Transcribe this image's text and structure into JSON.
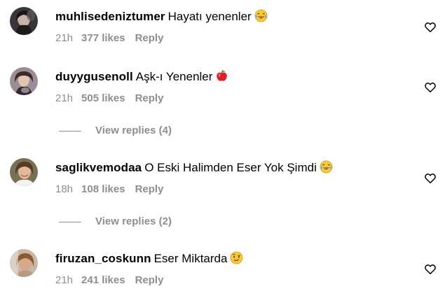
{
  "comments": [
    {
      "username": "muhlisedeniztumer",
      "text": "Hayatı yenenler",
      "emoji": "tears-of-joy-emoji",
      "time": "21h",
      "likes": "377 likes",
      "reply": "Reply"
    },
    {
      "username": "duyygusenoll",
      "text": "Aşk-ı Yenenler",
      "emoji": "red-apple-emoji",
      "time": "21h",
      "likes": "505 likes",
      "reply": "Reply",
      "view_replies": "View replies (4)"
    },
    {
      "username": "saglikvemodaa",
      "text": "O Eski Halimden Eser Yok Şimdi",
      "emoji": "tears-of-joy-emoji",
      "time": "18h",
      "likes": "108 likes",
      "reply": "Reply",
      "view_replies": "View replies (2)"
    },
    {
      "username": "firuzan_coskunn",
      "text": "Eser Miktarda",
      "emoji": "raised-eyebrow-emoji",
      "time": "21h",
      "likes": "241 likes",
      "reply": "Reply"
    }
  ],
  "colors": {
    "meta_gray": "#8e8e8e",
    "text": "#000000",
    "background": "#ffffff"
  }
}
